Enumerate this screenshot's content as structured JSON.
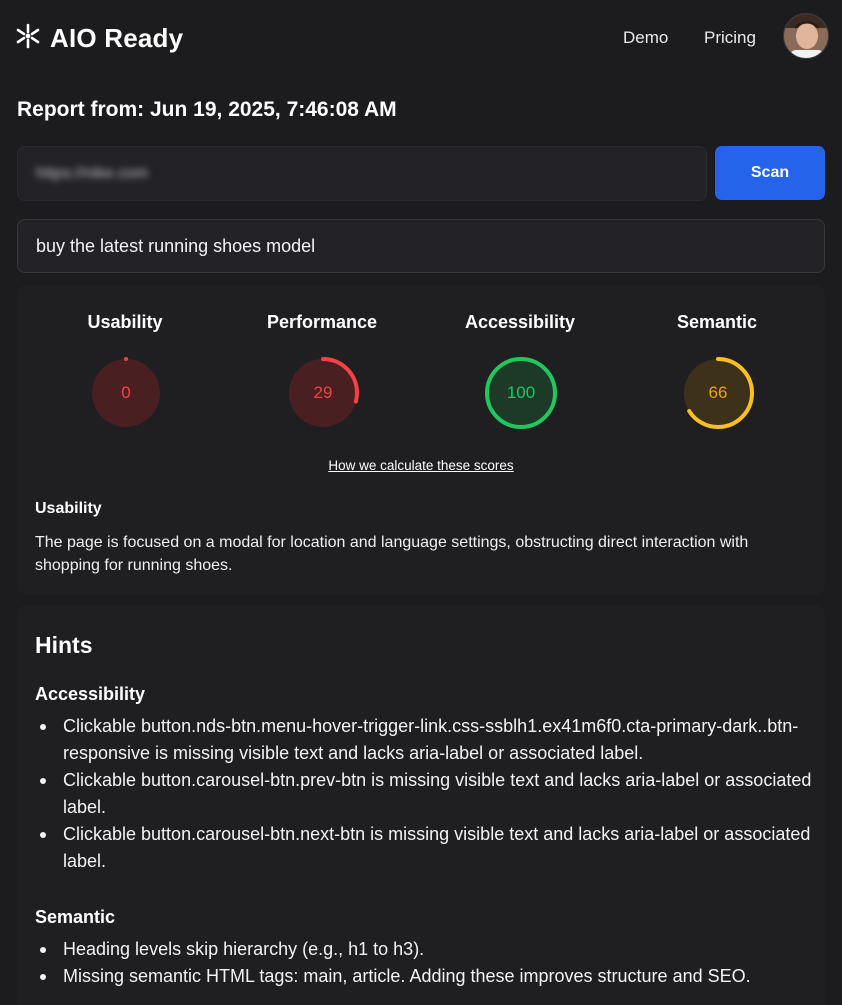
{
  "header": {
    "logo_text": "AIO Ready",
    "logo_icon": "sparkle-star-icon",
    "nav": [
      {
        "label": "Demo"
      },
      {
        "label": "Pricing"
      }
    ],
    "avatar_icon": "user-avatar"
  },
  "report": {
    "title": "Report from: Jun 19, 2025, 7:46:08 AM"
  },
  "scan": {
    "url_value": "https://nike.com",
    "button_label": "Scan"
  },
  "task": {
    "value": "buy the latest running shoes model"
  },
  "scores": [
    {
      "label": "Usability",
      "value": "0",
      "fraction": 0.0,
      "color": "#ef4444",
      "fill": "#4a1f22",
      "text_color": "#ef4444"
    },
    {
      "label": "Performance",
      "value": "29",
      "fraction": 0.29,
      "color": "#ef4444",
      "fill": "#4a1f22",
      "text_color": "#ef4444"
    },
    {
      "label": "Accessibility",
      "value": "100",
      "fraction": 1.0,
      "color": "#22c55e",
      "fill": "#1d3a28",
      "text_color": "#22c55e"
    },
    {
      "label": "Semantic",
      "value": "66",
      "fraction": 0.66,
      "color": "#fbbf24",
      "fill": "#3d3219",
      "text_color": "#f59e0b"
    }
  ],
  "calc_link": "How we calculate these scores",
  "usability_detail": {
    "heading": "Usability",
    "text": "The page is focused on a modal for location and language settings, obstructing direct interaction with shopping for running shoes."
  },
  "hints": {
    "title": "Hints",
    "sections": [
      {
        "heading": "Accessibility",
        "items": [
          "Clickable button.nds-btn.menu-hover-trigger-link.css-ssblh1.ex41m6f0.cta-primary-dark..btn-responsive is missing visible text and lacks aria-label or associated label.",
          "Clickable button.carousel-btn.prev-btn is missing visible text and lacks aria-label or associated label.",
          "Clickable button.carousel-btn.next-btn is missing visible text and lacks aria-label or associated label."
        ]
      },
      {
        "heading": "Semantic",
        "items": [
          "Heading levels skip hierarchy (e.g., h1 to h3).",
          "Missing semantic HTML tags: main, article. Adding these improves structure and SEO."
        ]
      }
    ]
  },
  "colors": {
    "background": "#1c1c1f",
    "accent": "#2563eb"
  }
}
